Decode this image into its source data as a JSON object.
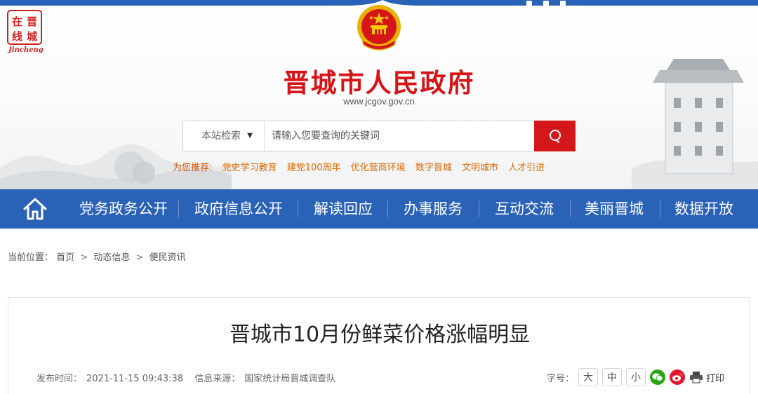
{
  "header": {
    "local_logo": {
      "chars": [
        "在",
        "晋",
        "线",
        "城"
      ],
      "latin": "Jincheng"
    },
    "title": "晋城市人民政府",
    "url": "www.jcgov.gov.cn"
  },
  "search": {
    "scope": "本站检索",
    "placeholder": "请输入您要查询的关键词",
    "button_icon": "search-icon"
  },
  "recommend": {
    "label": "为您推荐:",
    "items": [
      "党史学习教育",
      "建党100周年",
      "优化营商环境",
      "数字晋城",
      "文明城市",
      "人才引进"
    ]
  },
  "nav": {
    "home_icon": "home-icon",
    "items": [
      "党务政务公开",
      "政府信息公开",
      "解读回应",
      "办事服务",
      "互动交流",
      "美丽晋城",
      "数据开放"
    ]
  },
  "breadcrumb": {
    "label": "当前位置：",
    "items": [
      "首页",
      "动态信息",
      "便民资讯"
    ]
  },
  "article": {
    "title": "晋城市10月份鲜菜价格涨幅明显",
    "publish_label": "发布时间：",
    "publish_time": "2021-11-15 09:43:38",
    "source_label": "信息来源：",
    "source": "国家统计局晋城调查队",
    "font_size_label": "字号：",
    "font_sizes": [
      "大",
      "中",
      "小"
    ],
    "share_icons": [
      "wechat-icon",
      "weibo-icon"
    ],
    "print_label": "打印"
  },
  "colors": {
    "brand_red": "#d61518",
    "nav_blue": "#2a62b8",
    "recommend_orange": "#e06a00",
    "search_button": "#d3171b"
  }
}
